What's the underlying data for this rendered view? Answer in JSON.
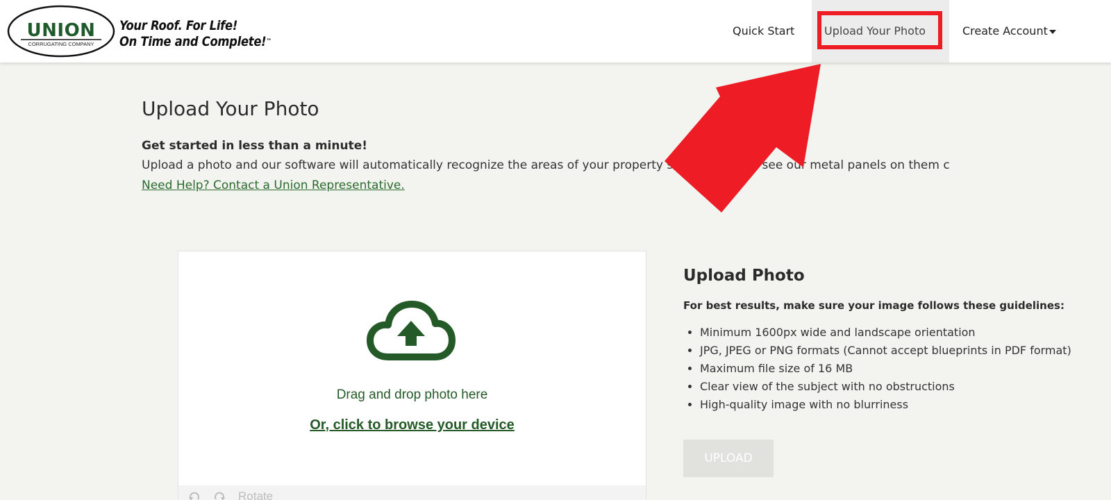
{
  "header": {
    "logo": {
      "brand": "UNION",
      "subtext": "CORRUGATING COMPANY"
    },
    "tagline": {
      "line1": "Your Roof. For Life!",
      "line2": "On Time and Complete!",
      "trademark": "™"
    },
    "nav": {
      "quick_start": "Quick Start",
      "upload_photo": "Upload Your Photo",
      "create_account": "Create Account"
    }
  },
  "main": {
    "title": "Upload Your Photo",
    "intro_strong": "Get started in less than a minute!",
    "intro_text": "Upload a photo and our software will automatically recognize the areas of your property so that you can see our metal panels on them c",
    "help_link": "Need Help? Contact a Union Representative."
  },
  "dropzone": {
    "icon": "cloud-upload-icon",
    "drag_text": "Drag and drop photo here",
    "browse_text": "Or, click to browse your device",
    "rotate_label": "Rotate"
  },
  "guidelines": {
    "title": "Upload Photo",
    "subtitle": "For best results, make sure your image follows these guidelines:",
    "items": [
      "Minimum 1600px wide and landscape orientation",
      "JPG, JPEG or PNG formats (Cannot accept blueprints in PDF format)",
      "Maximum file size of 16 MB",
      "Clear view of the subject with no obstructions",
      "High-quality image with no blurriness"
    ],
    "upload_button": "UPLOAD"
  },
  "colors": {
    "brand_green": "#245a28",
    "highlight_red": "#ee1c25",
    "page_bg": "#f3f3ef"
  }
}
